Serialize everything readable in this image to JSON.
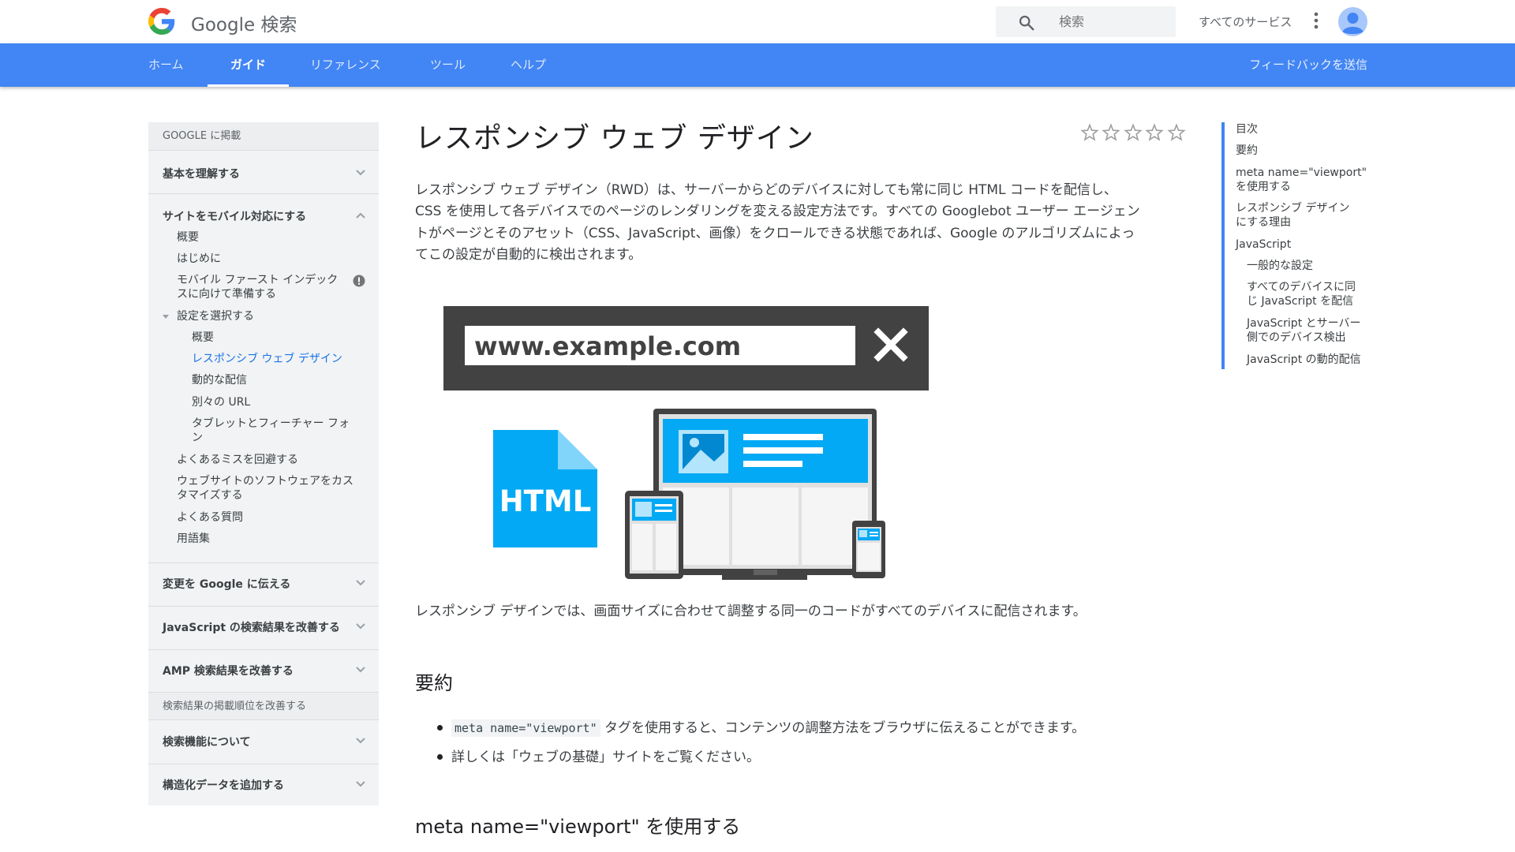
{
  "header": {
    "brand": "Google 検索",
    "search_placeholder": "検索",
    "all_services": "すべてのサービス"
  },
  "tabs": [
    {
      "label": "ホーム",
      "active": false
    },
    {
      "label": "ガイド",
      "active": true
    },
    {
      "label": "リファレンス",
      "active": false
    },
    {
      "label": "ツール",
      "active": false
    },
    {
      "label": "ヘルプ",
      "active": false
    }
  ],
  "feedback": "フィードバックを送信",
  "leftnav": {
    "section1": "GOOGLE に掲載",
    "group_basics": "基本を理解する",
    "group_mobile": "サイトをモバイル対応にする",
    "mobile_items": {
      "overview": "概要",
      "intro": "はじめに",
      "mobile_first_1": "モバイル ファースト インデック",
      "mobile_first_2": "スに向けて準備する",
      "choose_config": "設定を選択する",
      "sub_overview": "概要",
      "sub_rwd": "レスポンシブ ウェブ デザイン",
      "sub_dynamic": "動的な配信",
      "sub_separate": "別々の URL",
      "sub_tablet_1": "タブレットとフィーチャー フォ",
      "sub_tablet_2": "ン",
      "avoid_mistakes": "よくあるミスを回避する",
      "customize_1": "ウェブサイトのソフトウェアをカス",
      "customize_2": "タマイズする",
      "faq": "よくある質問",
      "glossary": "用語集"
    },
    "group_tell_google": "変更を Google に伝える",
    "group_js": "JavaScript の検索結果を改善する",
    "group_amp": "AMP 検索結果を改善する",
    "section2": "検索結果の掲載順位を改善する",
    "group_features": "検索機能について",
    "group_structured": "構造化データを追加する"
  },
  "article": {
    "title": "レスポンシブ ウェブ デザイン",
    "rating_stars": 0,
    "intro_lines": [
      "レスポンシブ ウェブ デザイン（RWD）は、サーバーからどのデバイスに対しても常に同じ HTML コードを配信し、",
      "CSS を使用して各デバイスでのページのレンダリングを変える設定方法です。すべての Googlebot ユーザー エージェン",
      "トがページとそのアセット（CSS、JavaScript、画像）をクロールできる状態であれば、Google のアルゴリズムによっ",
      "てこの設定が自動的に検出されます。"
    ],
    "illustration": {
      "url_text": "www.example.com",
      "file_label": "HTML"
    },
    "caption": "レスポンシブ デザインでは、画面サイズに合わせて調整する同一のコードがすべてのデバイスに配信されます。",
    "summary_heading": "要約",
    "bullet1_code": "meta name=\"viewport\"",
    "bullet1_text": " タグを使用すると、コンテンツの調整方法をブラウザに伝えることができます。",
    "bullet2_text": "詳しくは「ウェブの基礎」サイトをご覧ください。",
    "viewport_heading": "meta name=\"viewport\" を使用する"
  },
  "toc": {
    "title": "目次",
    "summary": "要約",
    "viewport_1": "meta name=\"viewport\"",
    "viewport_2": "を使用する",
    "why_1": "レスポンシブ デザイン",
    "why_2": "にする理由",
    "javascript": "JavaScript",
    "general": "一般的な設定",
    "same_js_1": "すべてのデバイスに同",
    "same_js_2": "じ JavaScript を配信",
    "server_1": "JavaScript とサーバー",
    "server_2": "側でのデバイス検出",
    "dynamic": "JavaScript の動的配信"
  },
  "colors": {
    "tab_bar": "#4285f4",
    "nav_bg": "#f1f3f4",
    "current_link": "#1a73e8",
    "illustration_blue": "#03a9f4",
    "illustration_dark": "#424242"
  }
}
